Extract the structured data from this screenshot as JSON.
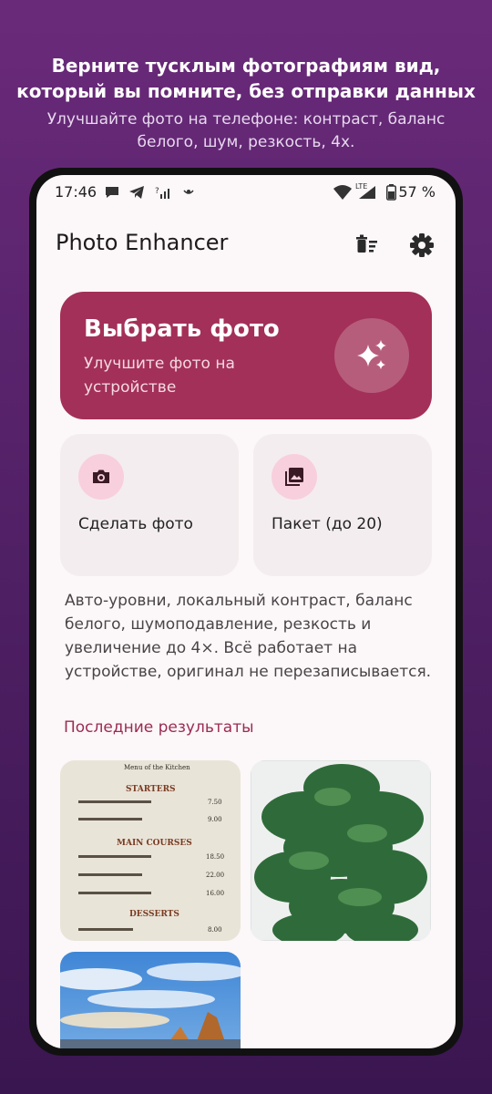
{
  "promo": {
    "title_line1": "Верните тусклым фотографиям вид,",
    "title_line2": "который вы помните, без отправки данных",
    "subtitle_line1": "Улучшайте фото на телефоне: контраст, баланс",
    "subtitle_line2": "белого, шум, резкость, 4x."
  },
  "status_bar": {
    "time": "17:46",
    "network": "LTE",
    "battery": "57 %"
  },
  "app": {
    "title": "Photo Enhancer"
  },
  "hero": {
    "title": "Выбрать фото",
    "subtitle": "Улучшите фото на устройстве"
  },
  "cards": {
    "camera_label": "Сделать фото",
    "batch_label": "Пакет (до 20)"
  },
  "description": "Авто-уровни, локальный контраст, баланс белого, шумоподавление, резкость и увеличение до 4×. Всё работает на устройстве, оригинал не перезаписывается.",
  "recent": {
    "title": "Последние результаты",
    "menu": {
      "header": "Menu of the Kitchen",
      "starters": "STARTERS",
      "main": "MAIN COURSES",
      "desserts": "DESSERTS",
      "price1": "7.50",
      "price2": "9.00",
      "price3": "18.50",
      "price4": "22.00",
      "price5": "16.00",
      "price6": "8.00"
    }
  },
  "colors": {
    "accent": "#a33058",
    "accent_text": "#9a2c54",
    "icon_bg": "#f8cfdd",
    "background_top": "#6a2a7a",
    "background_bottom": "#3a1650"
  }
}
